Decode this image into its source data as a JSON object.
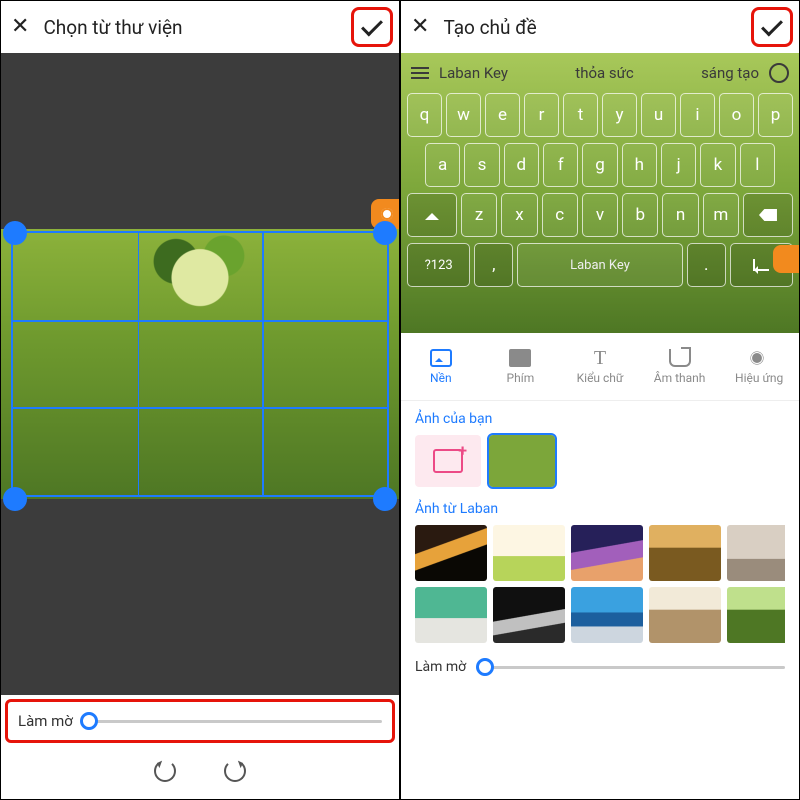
{
  "left": {
    "title": "Chọn từ thư viện",
    "blur_label": "Làm mờ",
    "blur_value_percent": 2
  },
  "right": {
    "title": "Tạo chủ đề",
    "suggestion_words": [
      "Laban Key",
      "thỏa sức",
      "sáng tạo"
    ],
    "keyboard": {
      "row1": [
        "q",
        "w",
        "e",
        "r",
        "t",
        "y",
        "u",
        "i",
        "o",
        "p"
      ],
      "row2": [
        "a",
        "s",
        "d",
        "f",
        "g",
        "h",
        "j",
        "k",
        "l"
      ],
      "row3": [
        "z",
        "x",
        "c",
        "v",
        "b",
        "n",
        "m"
      ],
      "sym_label": "?123",
      "space_label": "Laban Key",
      "comma": ",",
      "dot": "."
    },
    "tabs": [
      {
        "id": "nen",
        "label": "Nền",
        "active": true
      },
      {
        "id": "phim",
        "label": "Phím",
        "active": false
      },
      {
        "id": "kieuchu",
        "label": "Kiểu chữ",
        "active": false
      },
      {
        "id": "amthanh",
        "label": "Âm thanh",
        "active": false
      },
      {
        "id": "hieuung",
        "label": "Hiệu ứng",
        "active": false
      }
    ],
    "section_user_title": "Ảnh của bạn",
    "section_laban_title": "Ảnh từ Laban",
    "blur_label": "Làm mờ",
    "blur_value_percent": 3
  }
}
